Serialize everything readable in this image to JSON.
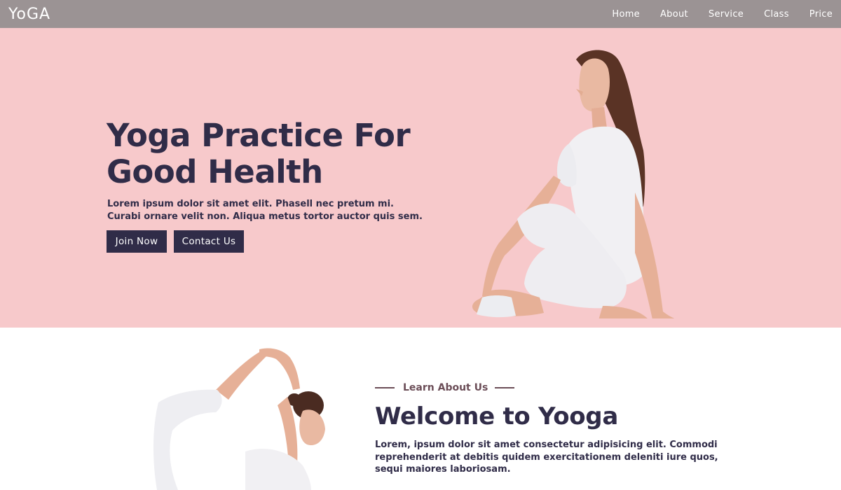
{
  "nav": {
    "logo": "YoGA",
    "items": [
      {
        "label": "Home"
      },
      {
        "label": "About"
      },
      {
        "label": "Service"
      },
      {
        "label": "Class"
      },
      {
        "label": "Price"
      }
    ]
  },
  "hero": {
    "title": "Yoga Practice For Good Health",
    "text": "Lorem ipsum dolor sit amet elit. Phasell nec pretum mi. Curabi ornare velit non. Aliqua metus tortor auctor quis sem.",
    "join_label": "Join Now",
    "contact_label": "Contact Us"
  },
  "about": {
    "eyebrow": "Learn About Us",
    "title": "Welcome to Yooga",
    "text": "Lorem, ipsum dolor sit amet consectetur adipisicing elit. Commodi reprehenderit at debitis quidem exercitationem deleniti iure quos, sequi maiores laboriosam."
  },
  "colors": {
    "nav_bg": "#9b9394",
    "hero_bg": "#f7c9cb",
    "primary": "#302c48",
    "accent": "#6b4d57"
  }
}
